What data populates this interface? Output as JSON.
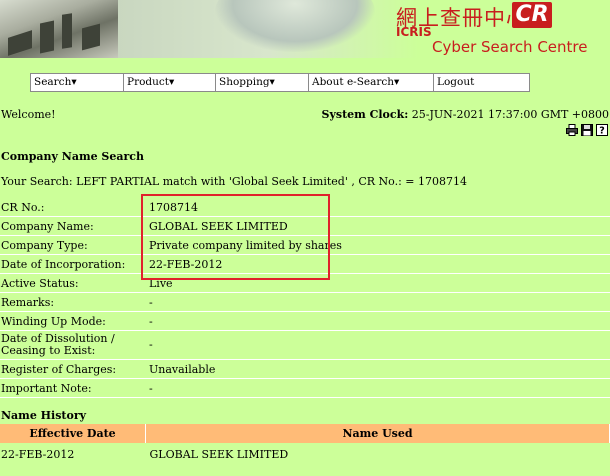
{
  "header": {
    "logo_chinese": "網上查冊中心",
    "logo_cr": "CR",
    "logo_icris": "ICRIS",
    "logo_subtitle": "Cyber Search Centre"
  },
  "menu": {
    "items": [
      {
        "label": "Search▾"
      },
      {
        "label": "Product▾"
      },
      {
        "label": "Shopping▾"
      },
      {
        "label": "About e-Search▾"
      },
      {
        "label": "Logout"
      }
    ]
  },
  "status": {
    "welcome": "Welcome!",
    "clock_label": "System Clock:",
    "clock_value": " 25-JUN-2021 17:37:00 GMT +0800"
  },
  "toolbar": {
    "icons": [
      "print-icon",
      "save-icon",
      "help-icon"
    ]
  },
  "company_search": {
    "title": "Company Name Search",
    "search_line": "Your Search: LEFT PARTIAL match with 'Global Seek Limited' , CR No.: = 1708714",
    "fields": [
      {
        "label": "CR No.:",
        "value": "1708714"
      },
      {
        "label": "Company Name:",
        "value": "GLOBAL SEEK LIMITED"
      },
      {
        "label": "Company Type:",
        "value": "Private company limited by shares"
      },
      {
        "label": "Date of Incorporation:",
        "value": "22-FEB-2012"
      },
      {
        "label": "Active Status:",
        "value": "Live"
      },
      {
        "label": "Remarks:",
        "value": "-"
      },
      {
        "label": "Winding Up Mode:",
        "value": "-"
      },
      {
        "label": "Date of Dissolution /",
        "label2": "Ceasing to Exist:",
        "value": "-"
      },
      {
        "label": "Register of Charges:",
        "value": "Unavailable"
      },
      {
        "label": "Important Note:",
        "value": "-"
      }
    ]
  },
  "name_history": {
    "title": "Name History",
    "columns": [
      "Effective Date",
      "Name Used"
    ],
    "rows": [
      {
        "date": "22-FEB-2012",
        "name": "GLOBAL SEEK LIMITED"
      }
    ]
  },
  "colors": {
    "page_background": "#ccff99",
    "history_header": "#ffbb77",
    "highlight_border": "#e0212c",
    "logo_red": "#c81e1e"
  }
}
